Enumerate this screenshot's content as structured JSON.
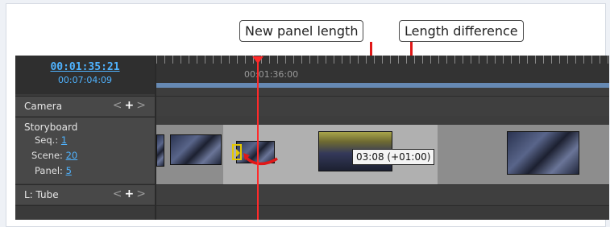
{
  "callouts": {
    "new_panel_length": "New panel length",
    "length_difference": "Length difference"
  },
  "timecode": {
    "current": "00:01:35:21",
    "total": "00:07:04:09"
  },
  "ruler": {
    "time_label": "00:01:36:00"
  },
  "tracks": {
    "camera": {
      "label": "Camera",
      "add_symbol": "+",
      "prev_symbol": "<",
      "next_symbol": ">"
    },
    "storyboard": {
      "label": "Storyboard",
      "seq_label": "Seq.:",
      "seq_value": "1",
      "scene_label": "Scene:",
      "scene_value": "20",
      "panel_label": "Panel:",
      "panel_value": "5"
    },
    "tube": {
      "label": "L: Tube",
      "add_symbol": "+",
      "prev_symbol": "<",
      "next_symbol": ">"
    }
  },
  "duration_tooltip": "03:08 (+01:00)",
  "colors": {
    "timecode_blue": "#4fb3ff",
    "playhead_red": "#ff2a2a",
    "callout_red": "#e01818"
  },
  "icons": {
    "trim": "trim-handle-icon",
    "drag": "drag-arrow-icon"
  }
}
